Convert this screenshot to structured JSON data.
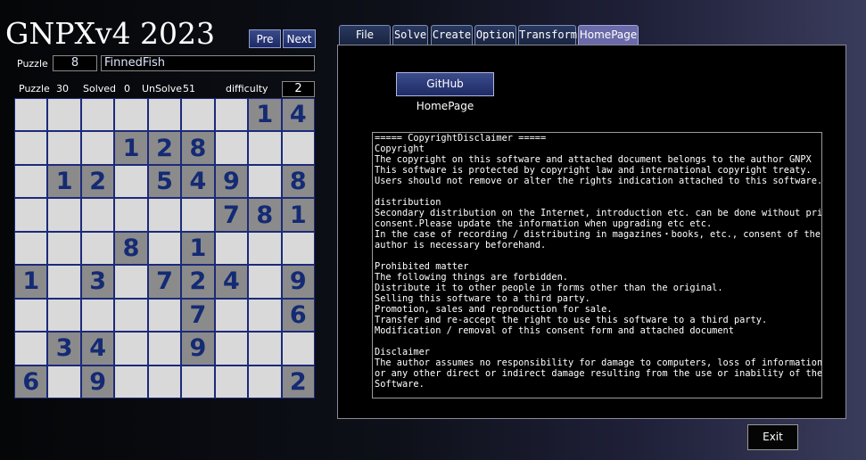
{
  "app": {
    "title": "GNPXv4 2023",
    "nav": {
      "prev_label": "Pre",
      "next_label": "Next"
    }
  },
  "puzzle": {
    "label": "Puzzle",
    "number": "8",
    "name": "FinnedFish"
  },
  "stats": {
    "puzzle_label": "Puzzle",
    "puzzle_value": "30",
    "solved_label": "Solved",
    "solved_value": "0",
    "unsolve_label": "UnSolve",
    "unsolve_value": "51",
    "difficulty_label": "difficulty",
    "difficulty_value": "2"
  },
  "grid": [
    [
      "",
      "",
      "",
      "",
      "",
      "",
      "",
      "1",
      "4"
    ],
    [
      "",
      "",
      "",
      "1",
      "2",
      "8",
      "",
      "",
      ""
    ],
    [
      "",
      "1",
      "2",
      "",
      "5",
      "4",
      "9",
      "",
      "8"
    ],
    [
      "",
      "",
      "",
      "",
      "",
      "",
      "7",
      "8",
      "1"
    ],
    [
      "",
      "",
      "",
      "8",
      "",
      "1",
      "",
      "",
      ""
    ],
    [
      "1",
      "",
      "3",
      "",
      "7",
      "2",
      "4",
      "",
      "9"
    ],
    [
      "",
      "",
      "",
      "",
      "",
      "7",
      "",
      "",
      "6"
    ],
    [
      "",
      "3",
      "4",
      "",
      "",
      "9",
      "",
      "",
      ""
    ],
    [
      "6",
      "",
      "9",
      "",
      "",
      "",
      "",
      "",
      "2"
    ]
  ],
  "tabs": [
    {
      "label": "File"
    },
    {
      "label": "Solve"
    },
    {
      "label": "Create"
    },
    {
      "label": "Option"
    },
    {
      "label": "Transform"
    },
    {
      "label": "HomePage",
      "active": true
    }
  ],
  "homepage": {
    "github_button": "GitHub HomePage",
    "disclaimer_lines": [
      "===== CopyrightDisclaimer =====",
      "Copyright",
      "The copyright on this software and attached document belongs to the author GNPX",
      "This software is protected by copyright law and international copyright treaty.",
      "Users should not remove or alter the rights indication attached to this software.",
      "",
      "distribution",
      "Secondary distribution on the Internet, introduction etc. can be done without prior",
      "consent.Please update the information when upgrading etc etc.",
      "In the case of recording / distributing in magazines・books, etc., consent of the",
      "author is necessary beforehand.",
      "",
      "Prohibited matter",
      "The following things are forbidden.",
      "Distribute it to other people in forms other than the original.",
      "Selling this software to a third party.",
      "Promotion, sales and reproduction for sale.",
      "Transfer and re-accept the right to use this software to a third party.",
      "Modification / removal of this consent form and attached document",
      "",
      "Disclaimer",
      "The author assumes no responsibility for damage to computers, loss of information",
      "or any other direct or indirect damage resulting from the use or inability of the",
      "Software."
    ]
  },
  "exit_label": "Exit"
}
